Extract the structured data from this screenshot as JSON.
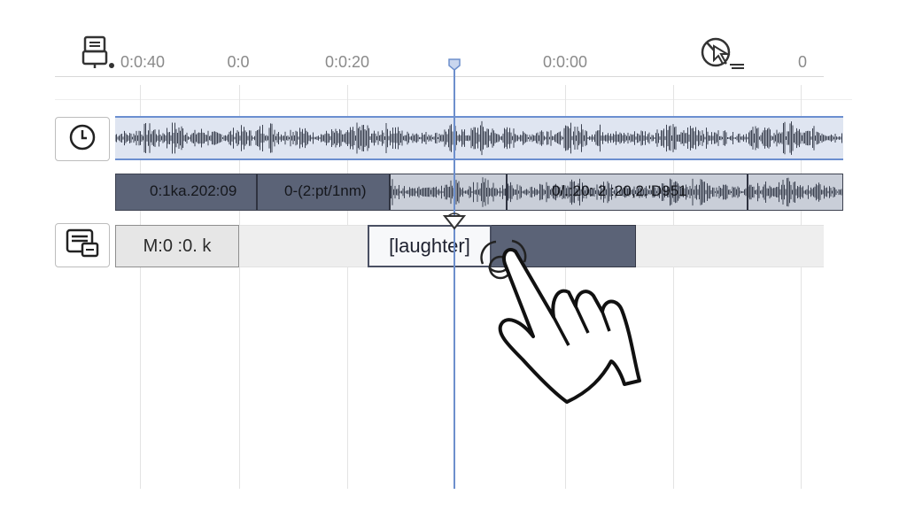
{
  "ruler": {
    "labels": [
      "0:0:40",
      "0:0",
      "0:0:20",
      "0:0:00",
      "0"
    ]
  },
  "tracks": {
    "audio_track_icon": "clock-icon",
    "caption_track_icon": "caption-icon",
    "segments": [
      {
        "label": "0:1ka.202:09"
      },
      {
        "label": "0-(2:pt/1nm)"
      },
      {
        "label": "0/.:20: 2 :20,2.'D951"
      }
    ],
    "captions": [
      {
        "label": "M:0 :0. k"
      },
      {
        "label": "[laughter]"
      }
    ]
  },
  "colors": {
    "playhead": "#6d8fcc",
    "segment_dark": "#5b6377",
    "waveform": "#3b4150",
    "track_highlight": "#dfe5f1"
  }
}
